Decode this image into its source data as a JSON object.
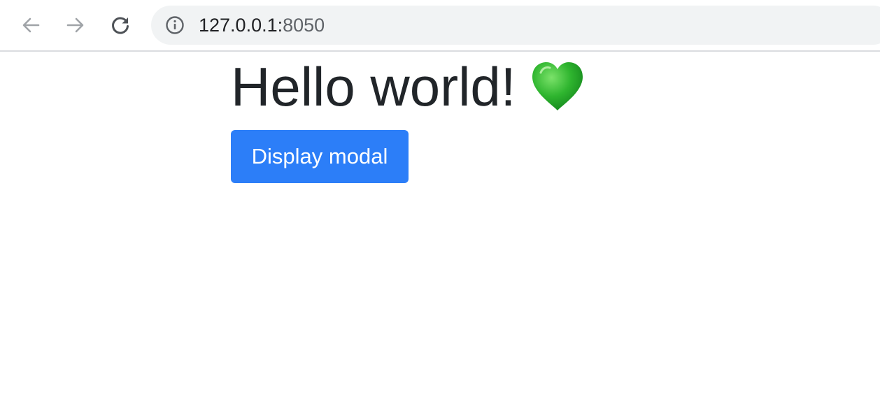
{
  "browser": {
    "url_host": "127.0.0.1:",
    "url_port": "8050",
    "icons": {
      "back": "arrow-left-icon",
      "forward": "arrow-right-icon",
      "reload": "reload-icon",
      "site_info": "info-icon"
    },
    "colors": {
      "toolbar_bg": "#ffffff",
      "omnibox_bg": "#f1f3f4",
      "disabled_icon": "#a0a4a8",
      "active_icon": "#5f6368"
    }
  },
  "page": {
    "heading": "Hello world!",
    "heading_emoji": "green-heart-icon",
    "button_label": "Display modal",
    "colors": {
      "heading": "#212529",
      "button_bg": "#2c7ef8",
      "button_text": "#ffffff",
      "heart": "#2fb52f"
    }
  }
}
